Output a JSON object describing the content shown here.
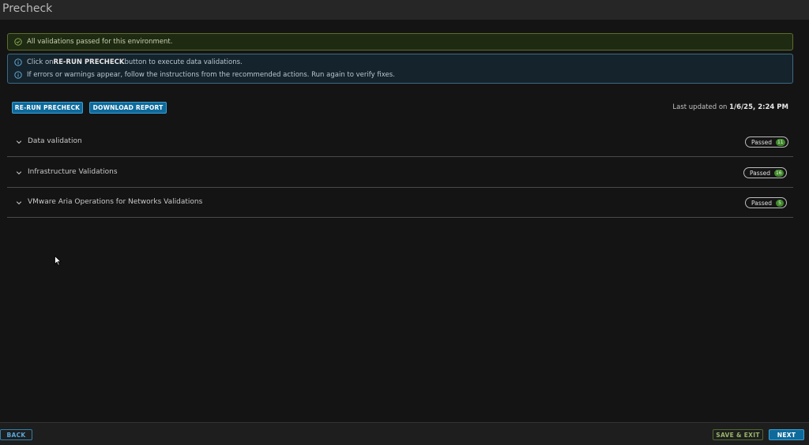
{
  "header": {
    "title": "Precheck"
  },
  "banners": {
    "success": "All validations passed for this environment.",
    "info_line1": {
      "prefix": "Click on ",
      "emphasis": "RE-RUN PRECHECK",
      "suffix": " button to execute data validations."
    },
    "info_line2": "If errors or warnings appear, follow the instructions from the recommended actions. Run again to verify fixes."
  },
  "toolbar": {
    "rerun_label": "RE-RUN PRECHECK",
    "download_label": "DOWNLOAD REPORT",
    "last_updated_prefix": "Last updated on ",
    "last_updated_value": "1/6/25, 2:24 PM"
  },
  "sections": [
    {
      "label": "Data validation",
      "status": "Passed",
      "count": "11"
    },
    {
      "label": "Infrastructure Validations",
      "status": "Passed",
      "count": "16"
    },
    {
      "label": "VMware Aria Operations for Networks Validations",
      "status": "Passed",
      "count": "5"
    }
  ],
  "footer": {
    "back_label": "BACK",
    "save_exit_label": "SAVE & EXIT",
    "next_label": "NEXT"
  },
  "colors": {
    "success": "#5a6e2c",
    "info": "#3c6a82",
    "primary": "#0e6a9b",
    "badge_count": "#3f8a2a"
  },
  "icons": {
    "success": "check-circle-icon",
    "info": "info-circle-icon",
    "expand": "chevron-down-icon",
    "pointer": "mouse-pointer-icon"
  }
}
